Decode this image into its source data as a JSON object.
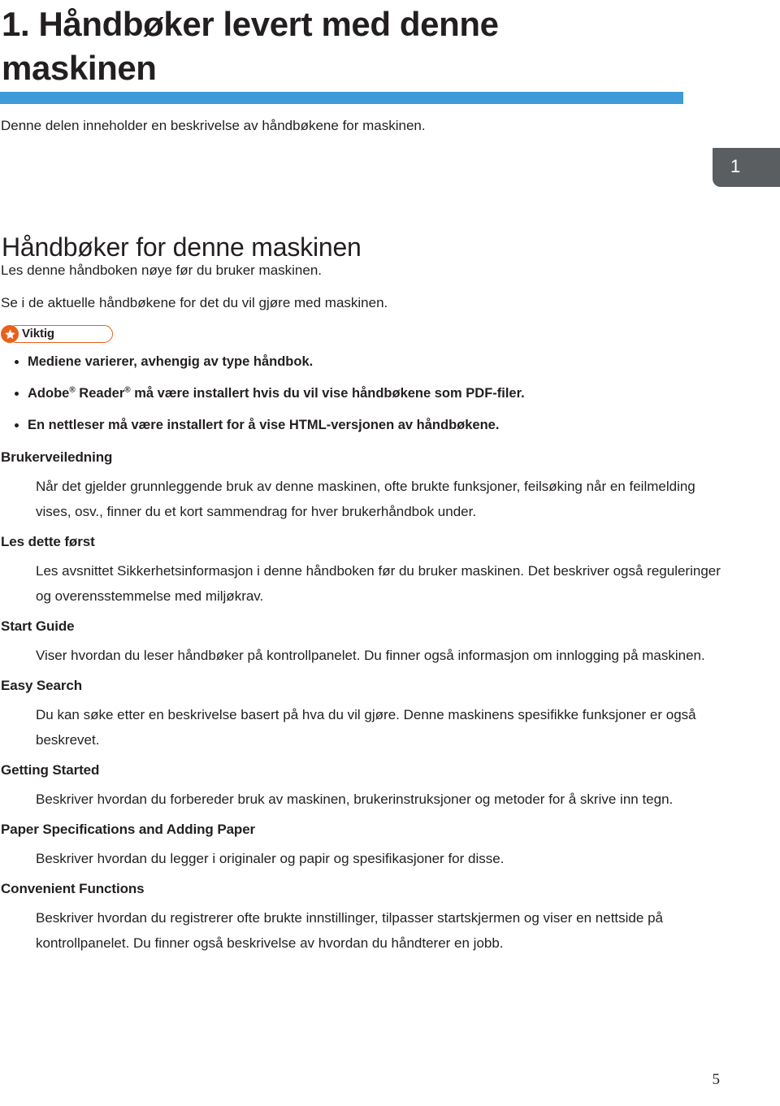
{
  "chapter": {
    "title": "1. Håndbøker levert med denne maskinen",
    "tab_number": "1",
    "intro": "Denne delen inneholder en beskrivelse av håndbøkene for maskinen."
  },
  "section": {
    "heading": "Håndbøker for denne maskinen",
    "lead_lines": [
      "Les denne håndboken nøye før du bruker maskinen.",
      "Se i de aktuelle håndbøkene for det du vil gjøre med maskinen."
    ]
  },
  "notice": {
    "label": "Viktig",
    "icon": "star-icon",
    "accent_color": "#e8601c",
    "bullets": [
      {
        "text_before": "Mediene varierer, avhengig av type håndbok.",
        "has_registered_marks": false
      },
      {
        "text_before": "Adobe",
        "mark_1": "®",
        "text_middle": " Reader",
        "mark_2": "®",
        "text_after": " må være installert hvis du vil vise håndbøkene som PDF-filer.",
        "has_registered_marks": true
      },
      {
        "text_before": "En nettleser må være installert for å vise HTML-versjonen av håndbøkene.",
        "has_registered_marks": false
      }
    ]
  },
  "manuals": [
    {
      "title": "Brukerveiledning",
      "description": "Når det gjelder grunnleggende bruk av denne maskinen, ofte brukte funksjoner, feilsøking når en feilmelding vises, osv., finner du et kort sammendrag for hver brukerhåndbok under."
    },
    {
      "title": "Les dette først",
      "description": "Les avsnittet Sikkerhetsinformasjon i denne håndboken før du bruker maskinen. Det beskriver også reguleringer og overensstemmelse med miljøkrav."
    },
    {
      "title": "Start Guide",
      "description": "Viser hvordan du leser håndbøker på kontrollpanelet. Du finner også informasjon om innlogging på maskinen."
    },
    {
      "title": "Easy Search",
      "description": "Du kan søke etter en beskrivelse basert på hva du vil gjøre. Denne maskinens spesifikke funksjoner er også beskrevet."
    },
    {
      "title": "Getting Started",
      "description": "Beskriver hvordan du forbereder bruk av maskinen, brukerinstruksjoner og metoder for å skrive inn tegn."
    },
    {
      "title": "Paper Specifications and Adding Paper",
      "description": "Beskriver hvordan du legger i originaler og papir og spesifikasjoner for disse."
    },
    {
      "title": "Convenient Functions",
      "description": "Beskriver hvordan du registrerer ofte brukte innstillinger, tilpasser startskjermen og viser en nettside på kontrollpanelet. Du finner også beskrivelse av hvordan du håndterer en jobb."
    }
  ],
  "footer": {
    "page_number": "5"
  },
  "colors": {
    "accent_blue": "#3d9bd7",
    "tab_gray": "#5b5e60",
    "notice_orange": "#e8601c",
    "text": "#231f20"
  }
}
